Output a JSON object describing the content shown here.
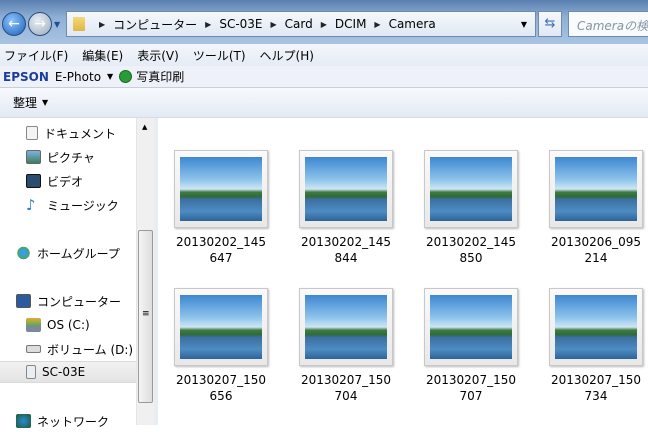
{
  "address": {
    "crumbs": [
      "コンピューター",
      "SC-03E",
      "Card",
      "DCIM",
      "Camera"
    ],
    "search_placeholder": "Cameraの検索"
  },
  "menu": [
    "ファイル(F)",
    "編集(E)",
    "表示(V)",
    "ツール(T)",
    "ヘルプ(H)"
  ],
  "epson": {
    "logo": "EPSON",
    "app": "E-Photo",
    "print": "写真印刷"
  },
  "toolbar": {
    "organize": "整理"
  },
  "nav": [
    {
      "label": "ドキュメント",
      "icon": "document-icon"
    },
    {
      "label": "ピクチャ",
      "icon": "pictures-icon"
    },
    {
      "label": "ビデオ",
      "icon": "video-icon"
    },
    {
      "label": "ミュージック",
      "icon": "music-icon"
    },
    {
      "label": "ホームグループ",
      "icon": "homegroup-icon"
    },
    {
      "label": "コンピューター",
      "icon": "computer-icon"
    },
    {
      "label": "OS (C:)",
      "icon": "drive-c-icon"
    },
    {
      "label": "ボリューム (D:)",
      "icon": "drive-d-icon"
    },
    {
      "label": "SC-03E",
      "icon": "phone-icon",
      "selected": true
    },
    {
      "label": "ネットワーク",
      "icon": "network-icon"
    }
  ],
  "files": [
    "20130202_145647",
    "20130202_145844",
    "20130202_145850",
    "20130206_095214",
    "20130207_150656",
    "20130207_150704",
    "20130207_150707",
    "20130207_150734"
  ]
}
